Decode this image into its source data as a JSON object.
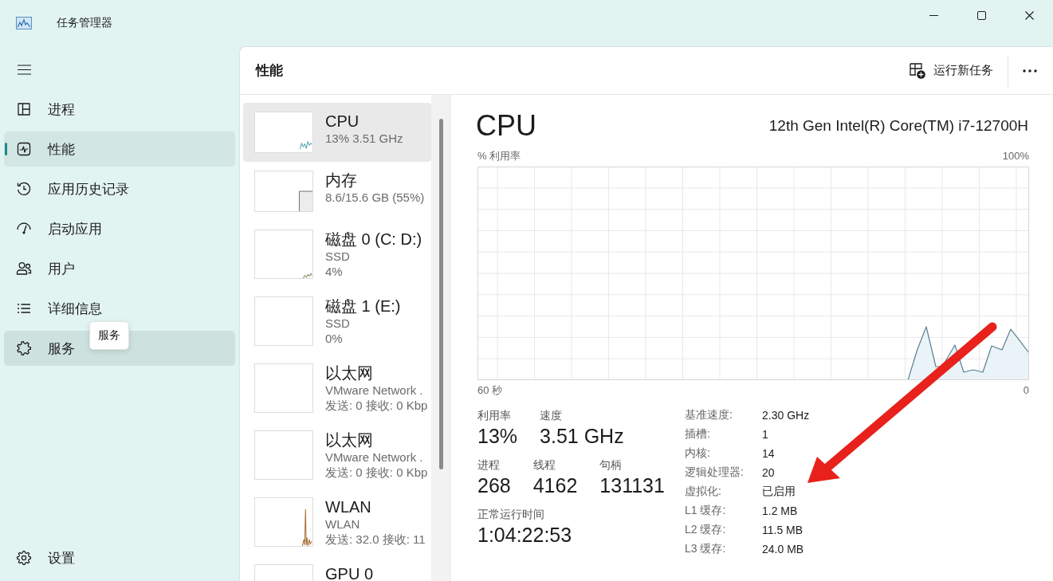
{
  "window": {
    "title": "任务管理器"
  },
  "sidebar": {
    "items": [
      {
        "label": "进程",
        "selected": false,
        "hovered": false
      },
      {
        "label": "性能",
        "selected": true,
        "hovered": false
      },
      {
        "label": "应用历史记录",
        "selected": false,
        "hovered": false
      },
      {
        "label": "启动应用",
        "selected": false,
        "hovered": false
      },
      {
        "label": "用户",
        "selected": false,
        "hovered": false
      },
      {
        "label": "详细信息",
        "selected": false,
        "hovered": false
      },
      {
        "label": "服务",
        "selected": false,
        "hovered": true
      }
    ],
    "tooltip": "服务",
    "settings": "设置"
  },
  "header": {
    "title": "性能",
    "run_new_task": "运行新任务"
  },
  "devices": [
    {
      "name": "CPU",
      "details": [
        "13% 3.51 GHz"
      ],
      "selected": true
    },
    {
      "name": "内存",
      "details": [
        "8.6/15.6 GB (55%)"
      ],
      "selected": false
    },
    {
      "name": "磁盘 0 (C: D:)",
      "details": [
        "SSD",
        "4%"
      ],
      "selected": false
    },
    {
      "name": "磁盘 1 (E:)",
      "details": [
        "SSD",
        "0%"
      ],
      "selected": false
    },
    {
      "name": "以太网",
      "details": [
        "VMware Network .",
        "发送: 0 接收: 0 Kbp"
      ],
      "selected": false
    },
    {
      "name": "以太网",
      "details": [
        "VMware Network .",
        "发送: 0 接收: 0 Kbp"
      ],
      "selected": false
    },
    {
      "name": "WLAN",
      "details": [
        "WLAN",
        "发送: 32.0 接收: 11"
      ],
      "selected": false
    },
    {
      "name": "GPU 0",
      "selected": false
    }
  ],
  "detail": {
    "title": "CPU",
    "model": "12th Gen Intel(R) Core(TM) i7-12700H",
    "graph": {
      "y_label": "% 利用率",
      "y_max": "100%",
      "x_start": "60 秒",
      "x_end": "0"
    },
    "stat_rows": [
      [
        {
          "label": "利用率",
          "value": "13%"
        },
        {
          "label": "速度",
          "value": "3.51 GHz"
        }
      ],
      [
        {
          "label": "进程",
          "value": "268"
        },
        {
          "label": "线程",
          "value": "4162"
        },
        {
          "label": "句柄",
          "value": "131131"
        }
      ],
      [
        {
          "label": "正常运行时间",
          "value": "1:04:22:53"
        }
      ]
    ],
    "specs": [
      {
        "label": "基准速度:",
        "value": "2.30 GHz"
      },
      {
        "label": "插槽:",
        "value": "1"
      },
      {
        "label": "内核:",
        "value": "14"
      },
      {
        "label": "逻辑处理器:",
        "value": "20"
      },
      {
        "label": "虚拟化:",
        "value": "已启用"
      },
      {
        "label": "L1 缓存:",
        "value": "1.2 MB"
      },
      {
        "label": "L2 缓存:",
        "value": "11.5 MB"
      },
      {
        "label": "L3 缓存:",
        "value": "24.0 MB"
      }
    ]
  }
}
